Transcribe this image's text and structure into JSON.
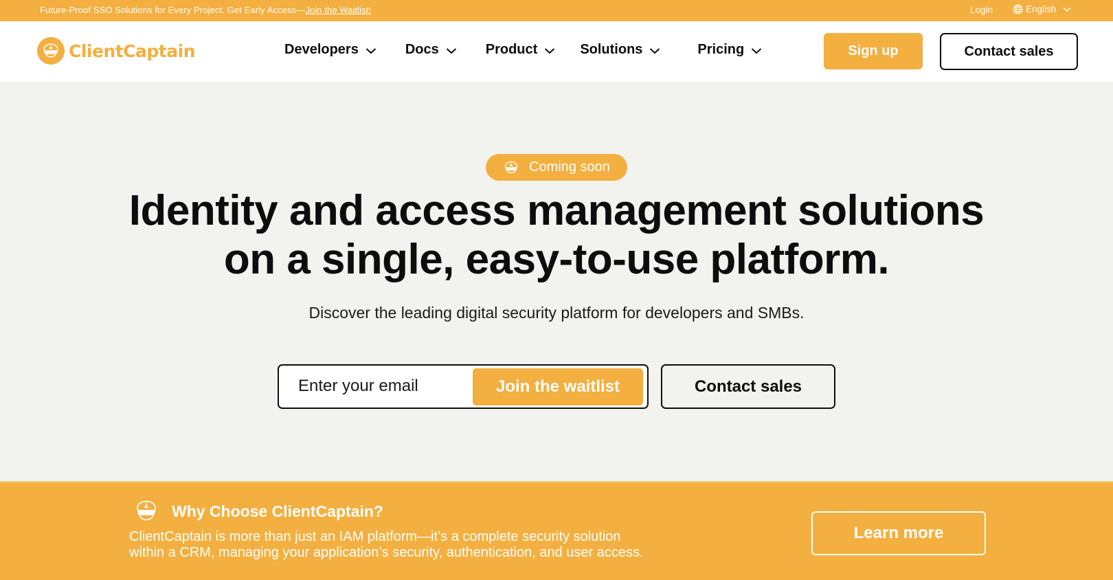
{
  "topbar": {
    "promo_text": "Future-Proof SSO Solutions for Every Project. Get Early Access—",
    "promo_link": "Join the Waitlist!",
    "login": "Login",
    "language": "English"
  },
  "brand": {
    "name": "ClientCaptain",
    "accent_color": "#f3af3f"
  },
  "nav": {
    "items": [
      {
        "label": "Developers"
      },
      {
        "label": "Docs"
      },
      {
        "label": "Product"
      },
      {
        "label": "Solutions"
      },
      {
        "label": "Pricing"
      }
    ],
    "signup": "Sign up",
    "contact_sales": "Contact sales"
  },
  "hero": {
    "badge": "Coming soon",
    "headline_line1": "Identity and access management solutions",
    "headline_line2": "on a single, easy-to-use platform.",
    "subheadline": "Discover the leading digital security platform for developers and SMBs.",
    "email_placeholder": "Enter your email",
    "email_value": "",
    "waitlist_button": "Join the waitlist",
    "contact_button": "Contact sales"
  },
  "why": {
    "title": "Why Choose ClientCaptain?",
    "text_line1": "ClientCaptain is more than just an IAM platform—it’s a complete security solution",
    "text_line2": "within a CRM, managing your application’s security, authentication, and user access.",
    "learn_more": "Learn more"
  }
}
